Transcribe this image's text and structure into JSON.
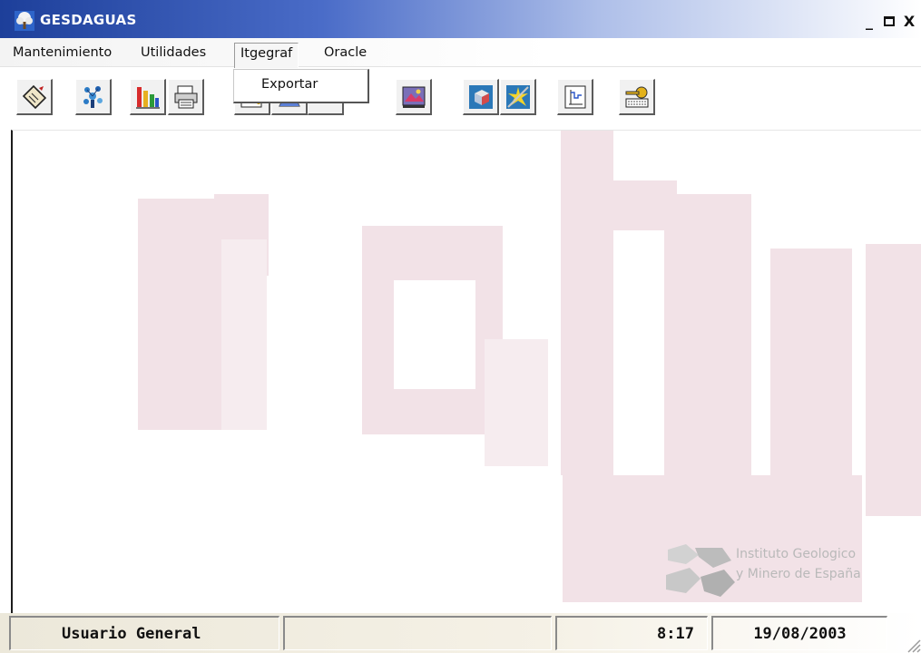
{
  "window": {
    "title": "GESDAGUAS",
    "controls": [
      "minimize",
      "maximize",
      "close"
    ],
    "close_glyph": "X",
    "minimize_glyph": "_"
  },
  "menu": {
    "items": [
      {
        "label": "Mantenimiento"
      },
      {
        "label": "Utilidades"
      },
      {
        "label": "Itgegraf"
      },
      {
        "label": "Oracle"
      }
    ],
    "open_menu": "Itgegraf",
    "dropdown": [
      {
        "label": "Exportar"
      }
    ]
  },
  "toolbar": {
    "buttons": [
      {
        "icon": "document-tool-icon"
      },
      {
        "icon": "tree-network-icon"
      },
      {
        "icon": "bar-chart-icon"
      },
      {
        "icon": "printer-icon"
      },
      {
        "icon": "map-pencil-icon"
      },
      {
        "icon": "flask-icon"
      },
      {
        "icon": "tool-arrow-icon"
      },
      {
        "icon": "photo-icon"
      },
      {
        "icon": "data-cube-icon"
      },
      {
        "icon": "starburst-icon"
      },
      {
        "icon": "graph-icon"
      },
      {
        "icon": "key-icon"
      }
    ]
  },
  "watermark": {
    "org_line1": "Instituto Geologico",
    "org_line2": "y Minero de España"
  },
  "status": {
    "user": "Usuario General",
    "empty_panel": "",
    "empty_panel2": "",
    "time": "8:17",
    "date": "19/08/2003"
  },
  "colors": {
    "titlebar_start": "#1d3f9a",
    "watermark_pink": "#f1dbe2",
    "status_bg": "#ece8da"
  }
}
